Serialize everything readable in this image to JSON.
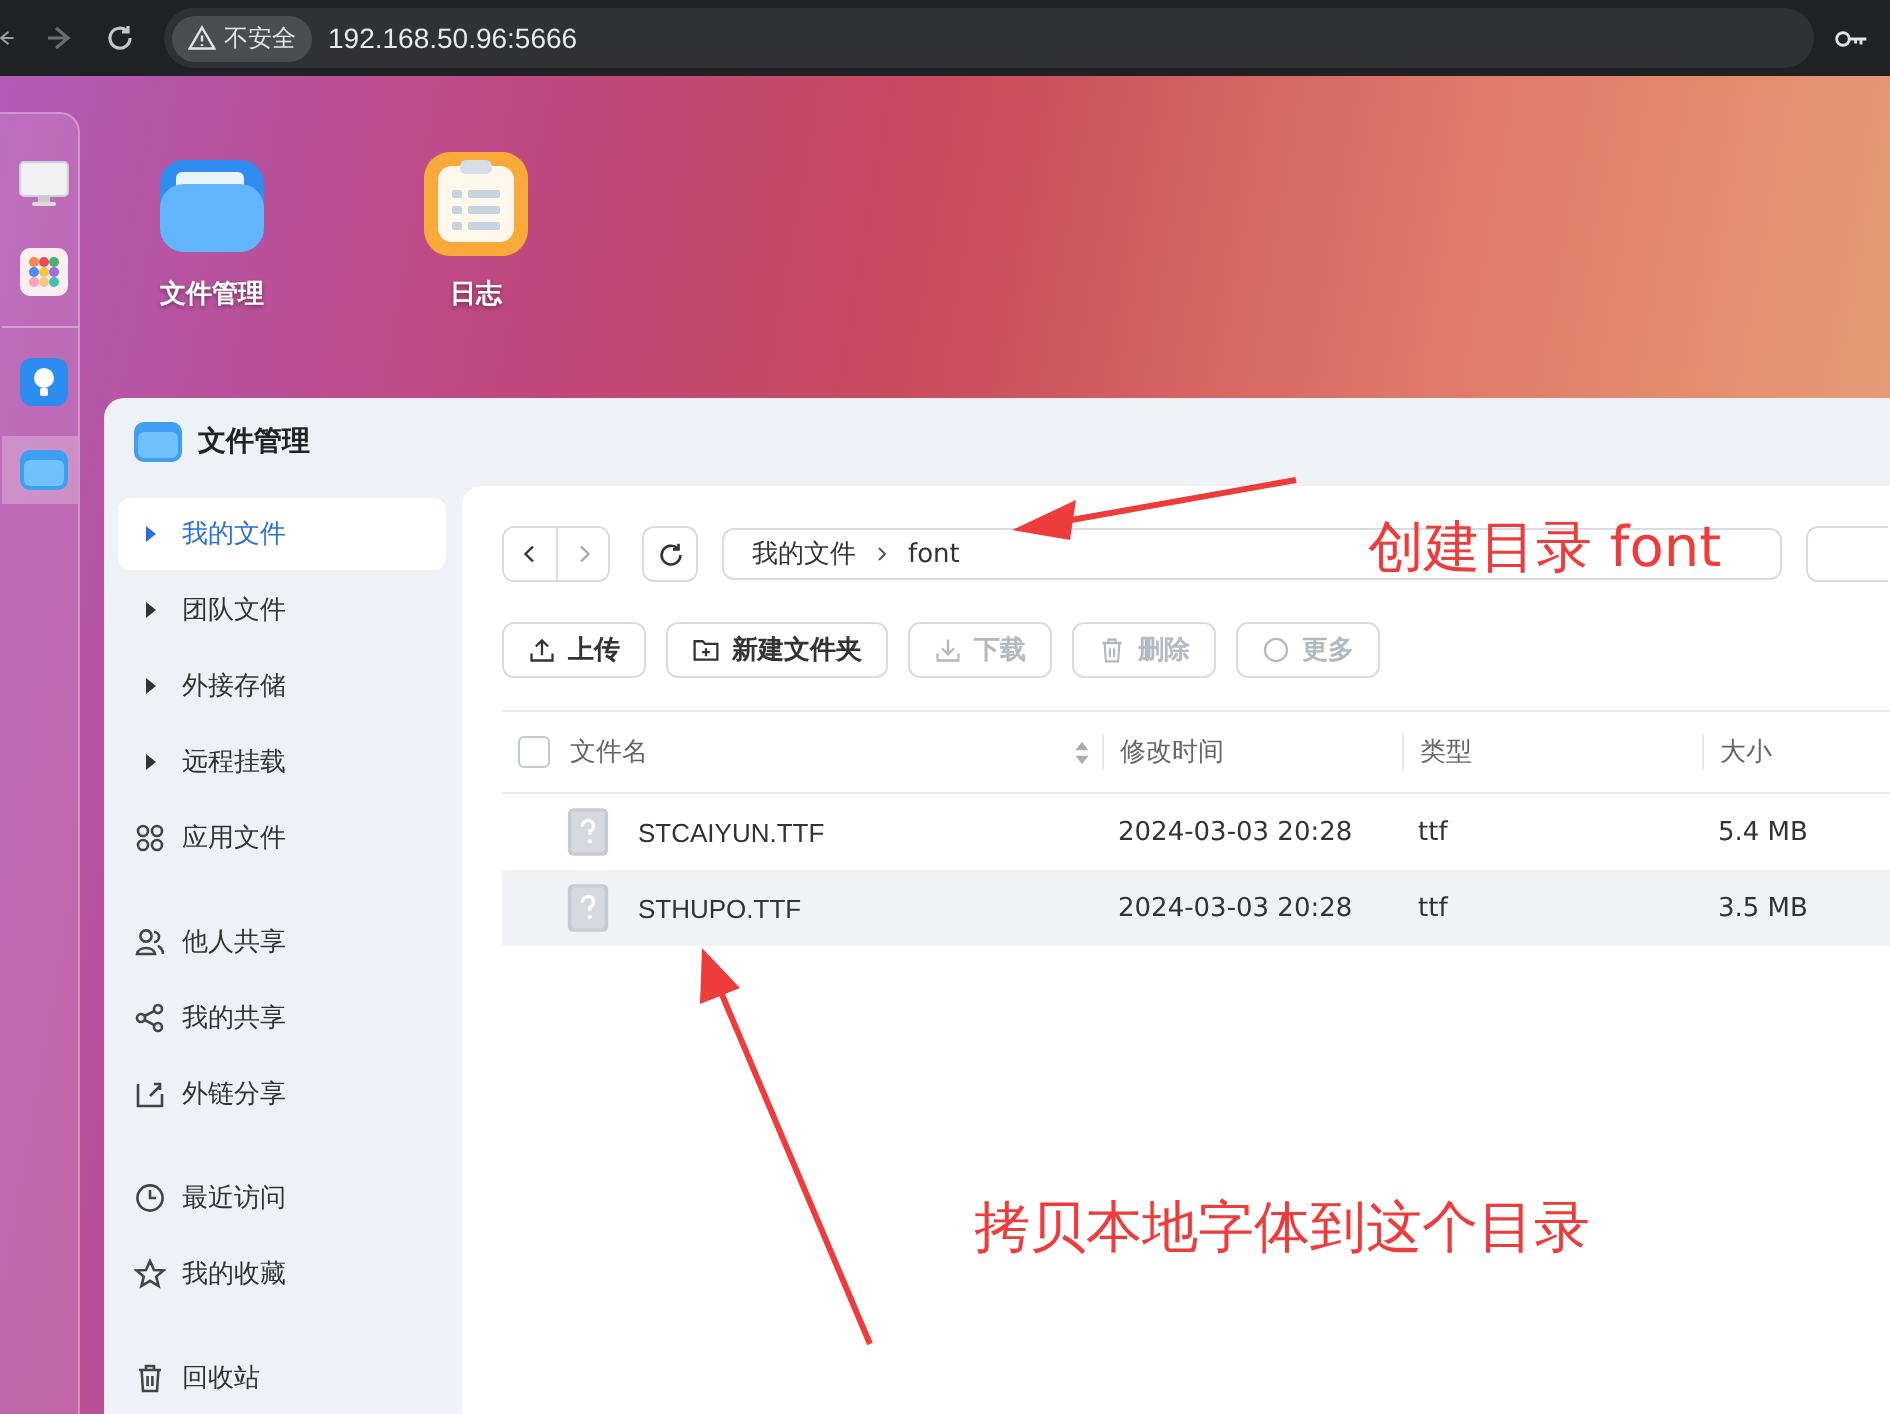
{
  "browser": {
    "security_label": "不安全",
    "url": "192.168.50.96:5666"
  },
  "dock": {
    "items": [
      {
        "selected": false
      },
      {
        "selected": false
      },
      {
        "selected": false
      },
      {
        "selected": true
      }
    ]
  },
  "desktop_icons": [
    {
      "label": "文件管理"
    },
    {
      "label": "日志"
    }
  ],
  "window": {
    "title": "文件管理"
  },
  "sidebar": {
    "groups": [
      [
        {
          "label": "我的文件",
          "kind": "tree",
          "selected": true
        },
        {
          "label": "团队文件",
          "kind": "tree",
          "selected": false
        },
        {
          "label": "外接存储",
          "kind": "tree",
          "selected": false
        },
        {
          "label": "远程挂载",
          "kind": "tree",
          "selected": false
        },
        {
          "label": "应用文件",
          "kind": "link",
          "selected": false
        }
      ],
      [
        {
          "label": "他人共享",
          "kind": "link",
          "selected": false
        },
        {
          "label": "我的共享",
          "kind": "link",
          "selected": false
        },
        {
          "label": "外链分享",
          "kind": "link",
          "selected": false
        }
      ],
      [
        {
          "label": "最近访问",
          "kind": "link",
          "selected": false
        },
        {
          "label": "我的收藏",
          "kind": "link",
          "selected": false
        }
      ],
      [
        {
          "label": "回收站",
          "kind": "link",
          "selected": false
        }
      ]
    ]
  },
  "breadcrumb": [
    "我的文件",
    "font"
  ],
  "toolbar": [
    {
      "label": "上传",
      "disabled": false
    },
    {
      "label": "新建文件夹",
      "disabled": false
    },
    {
      "label": "下载",
      "disabled": true
    },
    {
      "label": "删除",
      "disabled": true
    },
    {
      "label": "更多",
      "disabled": true
    }
  ],
  "table": {
    "select_all_checked": false,
    "columns": [
      "文件名",
      "修改时间",
      "类型",
      "大小"
    ],
    "rows": [
      {
        "name": "STCAIYUN.TTF",
        "modified": "2024-03-03 20:28",
        "type": "ttf",
        "size": "5.4 MB",
        "selected": false
      },
      {
        "name": "STHUPO.TTF",
        "modified": "2024-03-03 20:28",
        "type": "ttf",
        "size": "3.5 MB",
        "selected": true
      }
    ]
  },
  "annotations": [
    {
      "text": "创建目录 font"
    },
    {
      "text": "拷贝本地字体到这个目录"
    }
  ]
}
